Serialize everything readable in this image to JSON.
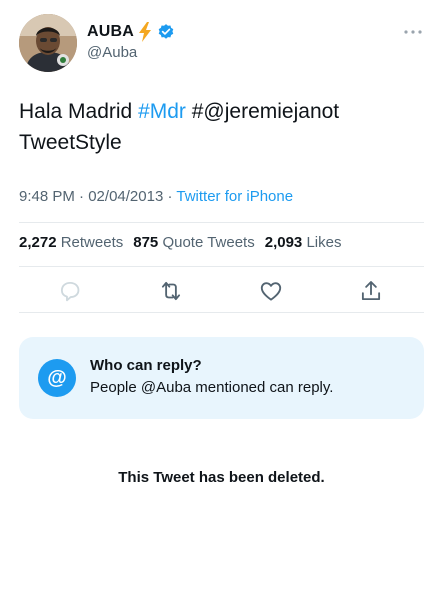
{
  "author": {
    "display_name": "AUBA",
    "handle": "@Auba",
    "name_emoji": "zap-emoji",
    "verified_badge": "verified-badge-icon",
    "avatar": "profile-photo"
  },
  "tweet": {
    "text_before": "Hala Madrid ",
    "hashtag": "#Mdr",
    "text_after": " #@jeremiejanot TweetStyle"
  },
  "meta": {
    "time": "9:48 PM",
    "separator": " · ",
    "date": "02/04/2013",
    "source": "Twitter for iPhone"
  },
  "stats": {
    "retweets_count": "2,272",
    "retweets_label": " Retweets",
    "quotes_count": "875",
    "quotes_label": " Quote Tweets",
    "likes_count": "2,093",
    "likes_label": " Likes"
  },
  "actions": {
    "reply": "reply-icon",
    "retweet": "retweet-icon",
    "like": "heart-icon",
    "share": "share-icon"
  },
  "reply_restriction": {
    "icon_text": "@",
    "title": "Who can reply?",
    "description": "People @Auba mentioned can reply."
  },
  "status": {
    "deleted_text": "This Tweet has been deleted."
  },
  "colors": {
    "accent": "#1d9bf0",
    "secondary_text": "#536471",
    "card_background": "#e8f5fd"
  }
}
